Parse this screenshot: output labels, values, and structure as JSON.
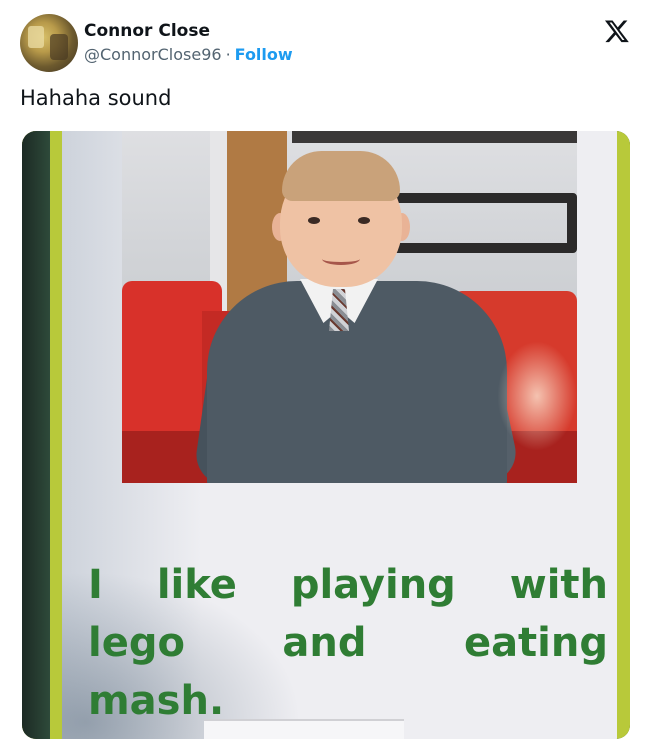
{
  "author": {
    "name": "Connor Close",
    "handle": "@ConnorClose96",
    "separator": "·",
    "follow_label": "Follow"
  },
  "platform_icon": "x-logo-icon",
  "tweet": {
    "text": "Hahaha sound"
  },
  "media": {
    "caption_lines": [
      [
        "I",
        "like",
        "playing",
        "with"
      ],
      [
        "lego",
        "and",
        "eating"
      ],
      [
        "mash."
      ]
    ],
    "caption_color": "#2f7d34"
  },
  "colors": {
    "link": "#1d9bf0",
    "secondary_text": "#536471",
    "primary_text": "#0f1419"
  }
}
